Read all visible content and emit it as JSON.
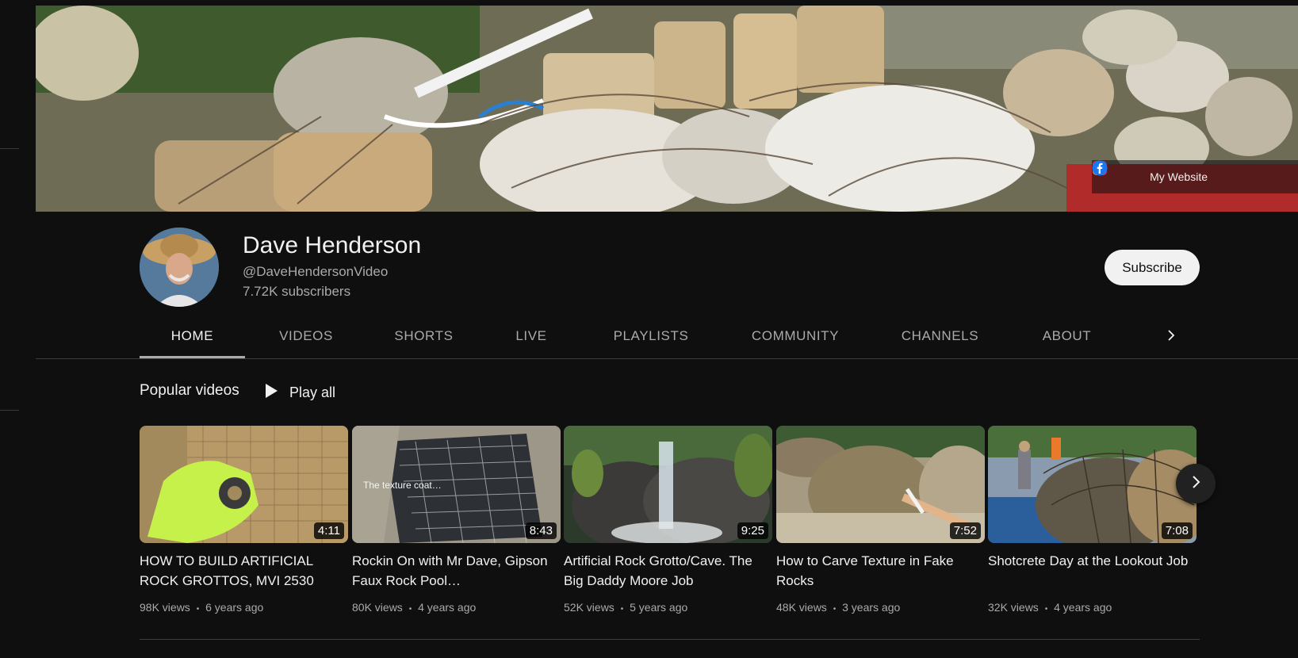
{
  "banner": {
    "link_label": "My Website",
    "icons": [
      "store-icon",
      "instagram-icon",
      "facebook-icon"
    ]
  },
  "channel": {
    "name": "Dave Henderson",
    "handle": "@DaveHendersonVideo",
    "subscribers": "7.72K subscribers",
    "subscribe_label": "Subscribe"
  },
  "tabs": [
    {
      "label": "HOME",
      "active": true
    },
    {
      "label": "VIDEOS"
    },
    {
      "label": "SHORTS"
    },
    {
      "label": "LIVE"
    },
    {
      "label": "PLAYLISTS"
    },
    {
      "label": "COMMUNITY"
    },
    {
      "label": "CHANNELS"
    },
    {
      "label": "ABOUT"
    }
  ],
  "section": {
    "title": "Popular videos",
    "play_all_label": "Play all"
  },
  "videos": [
    {
      "title": "HOW TO BUILD ARTIFICIAL ROCK GROTTOS, MVI 2530",
      "duration": "4:11",
      "views": "98K views",
      "age": "6 years ago"
    },
    {
      "title": "Rockin On with Mr Dave, Gipson Faux Rock Pool…",
      "duration": "8:43",
      "views": "80K views",
      "age": "4 years ago",
      "overlay_text": "The texture coat…"
    },
    {
      "title": "Artificial Rock Grotto/Cave. The Big Daddy Moore Job",
      "duration": "9:25",
      "views": "52K views",
      "age": "5 years ago"
    },
    {
      "title": "How to Carve Texture in Fake Rocks",
      "duration": "7:52",
      "views": "48K views",
      "age": "3 years ago"
    },
    {
      "title": "Shotcrete Day at the Lookout Job",
      "duration": "7:08",
      "views": "32K views",
      "age": "4 years ago"
    }
  ],
  "meta_separator": "•",
  "colors": {
    "background": "#0f0f0f",
    "text_primary": "#f1f1f1",
    "text_secondary": "#aaaaaa",
    "subscribe_bg": "#f1f1f1",
    "divider": "#3d3d3d"
  }
}
